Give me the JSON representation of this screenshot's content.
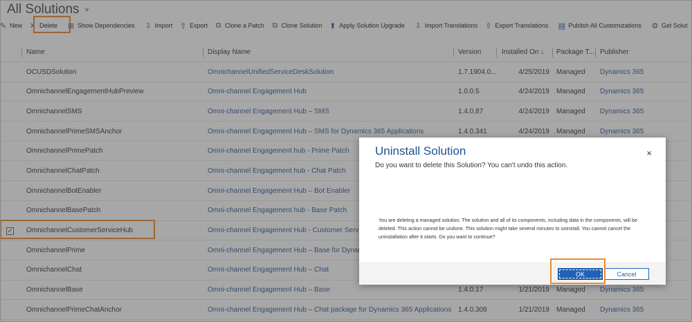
{
  "page": {
    "title": "All Solutions",
    "title_chevron": "˅"
  },
  "toolbar": [
    {
      "label": "New",
      "icon": "✎",
      "icon_name": "new-icon"
    },
    {
      "label": "Delete",
      "icon": "✕",
      "icon_name": "delete-icon"
    },
    {
      "label": "Show Dependencies",
      "icon": "⊞",
      "icon_name": "dependencies-icon"
    },
    {
      "label": "Import",
      "icon": "⇩",
      "icon_name": "import-icon"
    },
    {
      "label": "Export",
      "icon": "⇧",
      "icon_name": "export-icon"
    },
    {
      "label": "Clone a Patch",
      "icon": "⧉",
      "icon_name": "clone-patch-icon"
    },
    {
      "label": "Clone Solution",
      "icon": "⧉",
      "icon_name": "clone-solution-icon"
    },
    {
      "label": "Apply Solution Upgrade",
      "icon": "⬆",
      "icon_name": "upgrade-icon"
    },
    {
      "label": "Import Translations",
      "icon": "⇩",
      "icon_name": "import-translations-icon"
    },
    {
      "label": "Export Translations",
      "icon": "⇧",
      "icon_name": "export-translations-icon"
    },
    {
      "label": "Publish All Customizations",
      "icon": "▤",
      "icon_name": "publish-icon"
    },
    {
      "label": "Get Solut",
      "icon": "⚙",
      "icon_name": "get-solutions-icon"
    }
  ],
  "grid": {
    "columns": {
      "name": "Name",
      "display": "Display Name",
      "version": "Version",
      "installed": "Installed On ↓",
      "package": "Package T...",
      "publisher": "Publisher"
    },
    "rows": [
      {
        "name": "OCUSDSolution",
        "display": "OmnichannelUnifiedServiceDeskSolution",
        "version": "1.7.1904.0...",
        "installed": "4/25/2019",
        "package": "Managed",
        "publisher": "Dynamics 365",
        "checked": ""
      },
      {
        "name": "OmnichannelEngagementHubPreview",
        "display": "Omni-channel Engagement Hub",
        "version": "1.0.0.5",
        "installed": "4/24/2019",
        "package": "Managed",
        "publisher": "Dynamics 365",
        "checked": ""
      },
      {
        "name": "OmnichannelSMS",
        "display": "Omni-channel Engagement Hub – SMS",
        "version": "1.4.0.87",
        "installed": "4/24/2019",
        "package": "Managed",
        "publisher": "Dynamics 365",
        "checked": ""
      },
      {
        "name": "OmnichannelPrimeSMSAnchor",
        "display": "Omni-channel Engagement Hub – SMS for Dynamics 365 Applications",
        "version": "1.4.0.341",
        "installed": "4/24/2019",
        "package": "Managed",
        "publisher": "Dynamics 365",
        "checked": ""
      },
      {
        "name": "OmnichannelPrimePatch",
        "display": "Omni-channel Engagement hub - Prime Patch",
        "version": "",
        "installed": "",
        "package": "",
        "publisher": "",
        "checked": ""
      },
      {
        "name": "OmnichannelChatPatch",
        "display": "Omni-channel Engagement hub - Chat Patch",
        "version": "",
        "installed": "",
        "package": "",
        "publisher": "",
        "checked": ""
      },
      {
        "name": "OmnichannelBotEnabler",
        "display": "Omni-channel Engagement Hub – Bot Enabler",
        "version": "",
        "installed": "",
        "package": "",
        "publisher": "",
        "checked": ""
      },
      {
        "name": "OmnichannelBasePatch",
        "display": "Omni-channel Engagement hub - Base Patch",
        "version": "",
        "installed": "",
        "package": "",
        "publisher": "",
        "checked": ""
      },
      {
        "name": "OmnichannelCustomerServiceHub",
        "display": "Omni-channel Engagement Hub - Customer Servi",
        "version": "",
        "installed": "",
        "package": "",
        "publisher": "",
        "checked": "✓"
      },
      {
        "name": "OmnichannelPrime",
        "display": "Omni-channel Engagement Hub – Base for Dynar",
        "version": "",
        "installed": "",
        "package": "",
        "publisher": "",
        "checked": ""
      },
      {
        "name": "OmnichannelChat",
        "display": "Omni-channel Engagement Hub – Chat",
        "version": "",
        "installed": "",
        "package": "",
        "publisher": "",
        "checked": ""
      },
      {
        "name": "OmnichannelBase",
        "display": "Omni-channel Engagement Hub – Base",
        "version": "1.4.0.17",
        "installed": "1/21/2019",
        "package": "Managed",
        "publisher": "Dynamics 365",
        "checked": ""
      },
      {
        "name": "OmnichannelPrimeChatAnchor",
        "display": "Omni-channel Engagement Hub – Chat package for Dynamics 365 Applications",
        "version": "1.4.0.308",
        "installed": "1/21/2019",
        "package": "Managed",
        "publisher": "Dynamics 365",
        "checked": ""
      }
    ]
  },
  "modal": {
    "title": "Uninstall Solution",
    "subtitle": "Do you want to delete this Solution? You can't undo this action.",
    "close": "×",
    "body": "You are deleting a managed solution. The solution and all of its components, including data in the components, will be deleted. This action cannot be undone. This solution might take several minutes to uninstall. You cannot cancel the uninstallation after it starts. Do you want to continue?",
    "ok_label": "OK",
    "cancel_label": "Cancel"
  },
  "colors": {
    "highlight": "#f0892d",
    "accent": "#1f62b6",
    "link": "#2f5b9a"
  }
}
